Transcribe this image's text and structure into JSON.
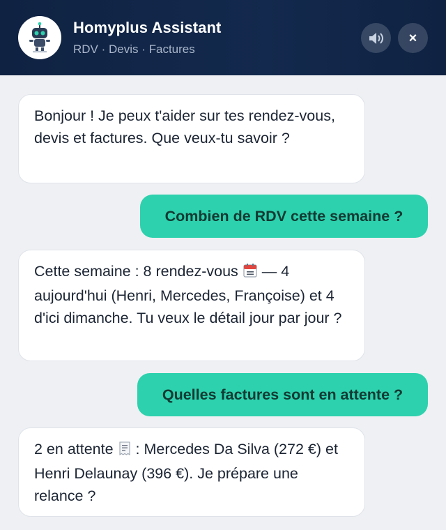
{
  "header": {
    "title": "Homyplus Assistant",
    "subtitle": "RDV · Devis · Factures",
    "avatar_icon": "robot-icon",
    "sound_icon": "speaker-icon",
    "close_label": "×"
  },
  "colors": {
    "header_bg": "#13294d",
    "user_bubble": "#2dd1ad",
    "bot_bubble": "#ffffff",
    "page_bg": "#eef0f3"
  },
  "messages": [
    {
      "role": "bot",
      "text": "Bonjour ! Je peux t'aider sur tes rendez-vous, devis et factures. Que veux-tu savoir ?"
    },
    {
      "role": "user",
      "text": "Combien de RDV cette semaine ?"
    },
    {
      "role": "bot",
      "text_before": "Cette semaine : 8 rendez-vous",
      "emoji": "calendar-icon",
      "text_after": "— 4 aujourd'hui (Henri, Mercedes, Françoise) et 4 d'ici dimanche. Tu veux le détail jour par jour ?"
    },
    {
      "role": "user",
      "text": "Quelles factures sont en attente ?"
    },
    {
      "role": "bot",
      "text_before": "2 en attente",
      "emoji": "receipt-icon",
      "text_after": ": Mercedes Da Silva (272 €) et Henri Delaunay (396 €). Je prépare une relance ?"
    }
  ]
}
